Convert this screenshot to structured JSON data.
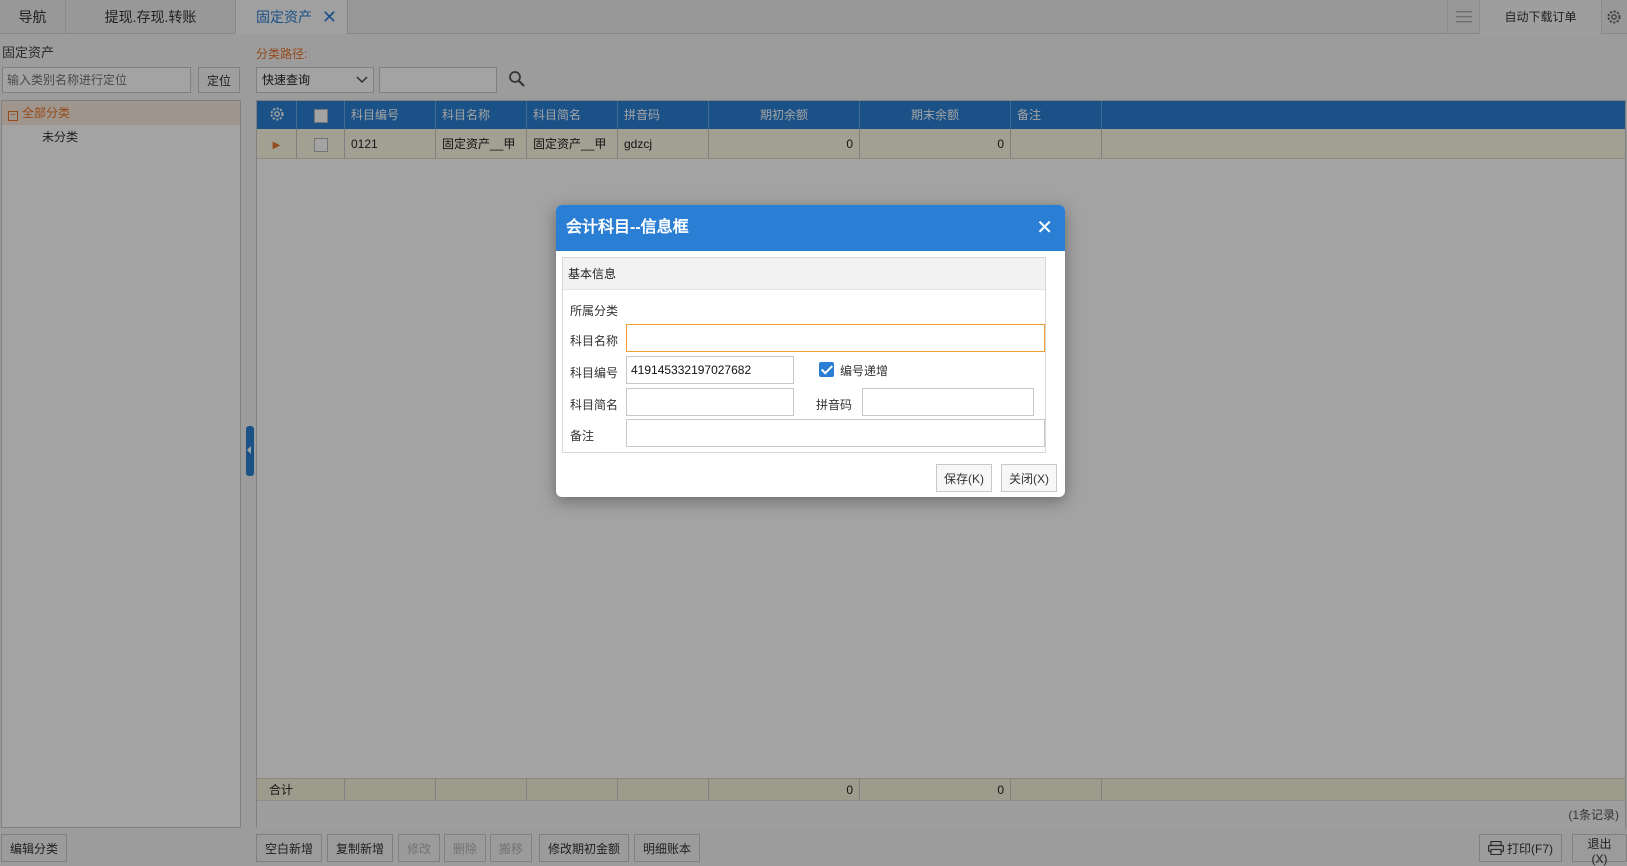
{
  "tabs": [
    {
      "label": "导航"
    },
    {
      "label": "提现.存现.转账"
    },
    {
      "label": "固定资产"
    }
  ],
  "toolbar_right": {
    "auto_download": "自动下载订单"
  },
  "left": {
    "title": "固定资产",
    "search_placeholder": "输入类别名称进行定位",
    "locate_label": "定位",
    "tree": {
      "root": "全部分类",
      "children": [
        "未分类"
      ]
    }
  },
  "right": {
    "path_label": "分类路径:",
    "quick_query": "快速查询"
  },
  "grid": {
    "columns": [
      "科目编号",
      "科目名称",
      "科目简名",
      "拼音码",
      "期初余额",
      "期末余额",
      "备注"
    ],
    "rows": [
      {
        "code": "0121",
        "name": "固定资产__甲",
        "short": "固定资产__甲",
        "pinyin": "gdzcj",
        "opening": "0",
        "closing": "0",
        "note": ""
      }
    ],
    "summary": {
      "label": "合计",
      "opening": "0",
      "closing": "0"
    },
    "record_count": "(1条记录)"
  },
  "bottom_left": {
    "edit_category": "编辑分类"
  },
  "bottom_actions": [
    "空白新增",
    "复制新增",
    "修改",
    "删除",
    "搬移",
    "修改期初金额",
    "明细账本"
  ],
  "bottom_right": {
    "print": "打印(F7)",
    "exit": "退出(X)"
  },
  "modal": {
    "title": "会计科目--信息框",
    "section": "基本信息",
    "labels": {
      "category": "所属分类",
      "name": "科目名称",
      "code": "科目编号",
      "short": "科目简名",
      "pinyin": "拼音码",
      "note": "备注"
    },
    "values": {
      "name": "",
      "code": "419145332197027682",
      "short": "",
      "pinyin": "",
      "note": ""
    },
    "auto_increment_label": "编号递增",
    "save_label": "保存(K)",
    "close_label": "关闭(X)"
  },
  "colors": {
    "accent": "#2a7fd4",
    "highlight": "#e8742a"
  }
}
